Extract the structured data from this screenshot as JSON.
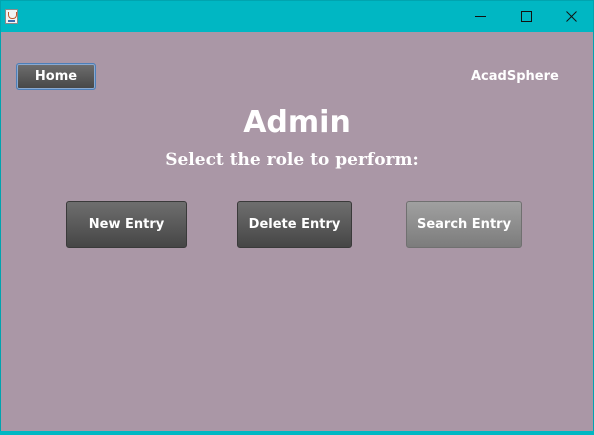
{
  "window": {
    "title_icon": "java-cup-icon",
    "controls": {
      "minimize": "minimize-icon",
      "maximize": "maximize-icon",
      "close": "close-icon"
    },
    "accent_color": "#00b7c3"
  },
  "header": {
    "home_label": "Home",
    "brand": "AcadSphere"
  },
  "main": {
    "title": "Admin",
    "subtitle": "Select the role to perform:",
    "background_color": "#aa97a6",
    "actions": [
      {
        "label": "New Entry"
      },
      {
        "label": "Delete Entry"
      },
      {
        "label": "Search Entry"
      }
    ]
  }
}
